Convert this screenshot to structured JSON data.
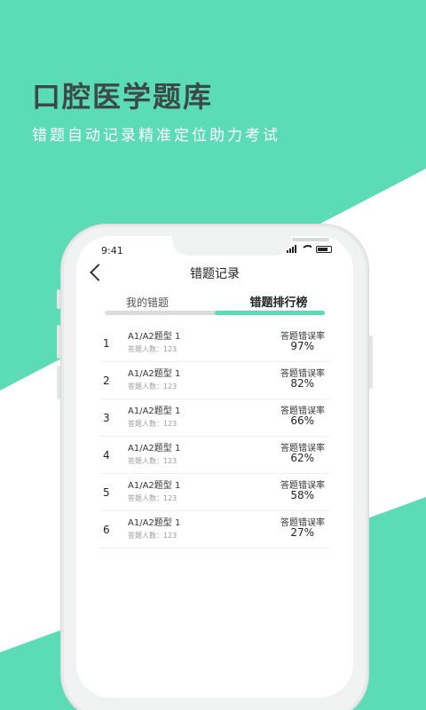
{
  "hero": {
    "title": "口腔医学题库",
    "subtitle": "错题自动记录精准定位助力考试"
  },
  "status_bar": {
    "time": "9:41",
    "icons": [
      "signal-icon",
      "wifi-icon",
      "battery-icon"
    ]
  },
  "nav": {
    "back_icon": "chevron-left-icon",
    "title": "错题记录"
  },
  "tabs": [
    {
      "label": "我的错题",
      "active": false
    },
    {
      "label": "错题排行榜",
      "active": true
    }
  ],
  "ranking": {
    "rate_label": "答题错误率",
    "count_label": "答题人数：",
    "rows": [
      {
        "rank": "1",
        "type": "A1/A2题型 1",
        "count": "123",
        "rate": "97%"
      },
      {
        "rank": "2",
        "type": "A1/A2题型 1",
        "count": "123",
        "rate": "82%"
      },
      {
        "rank": "3",
        "type": "A1/A2题型 1",
        "count": "123",
        "rate": "66%"
      },
      {
        "rank": "4",
        "type": "A1/A2题型 1",
        "count": "123",
        "rate": "62%"
      },
      {
        "rank": "5",
        "type": "A1/A2题型 1",
        "count": "123",
        "rate": "58%"
      },
      {
        "rank": "6",
        "type": "A1/A2题型 1",
        "count": "123",
        "rate": "27%"
      }
    ]
  },
  "colors": {
    "accent": "#5cdbb7",
    "hero_title": "#3c4a45"
  }
}
